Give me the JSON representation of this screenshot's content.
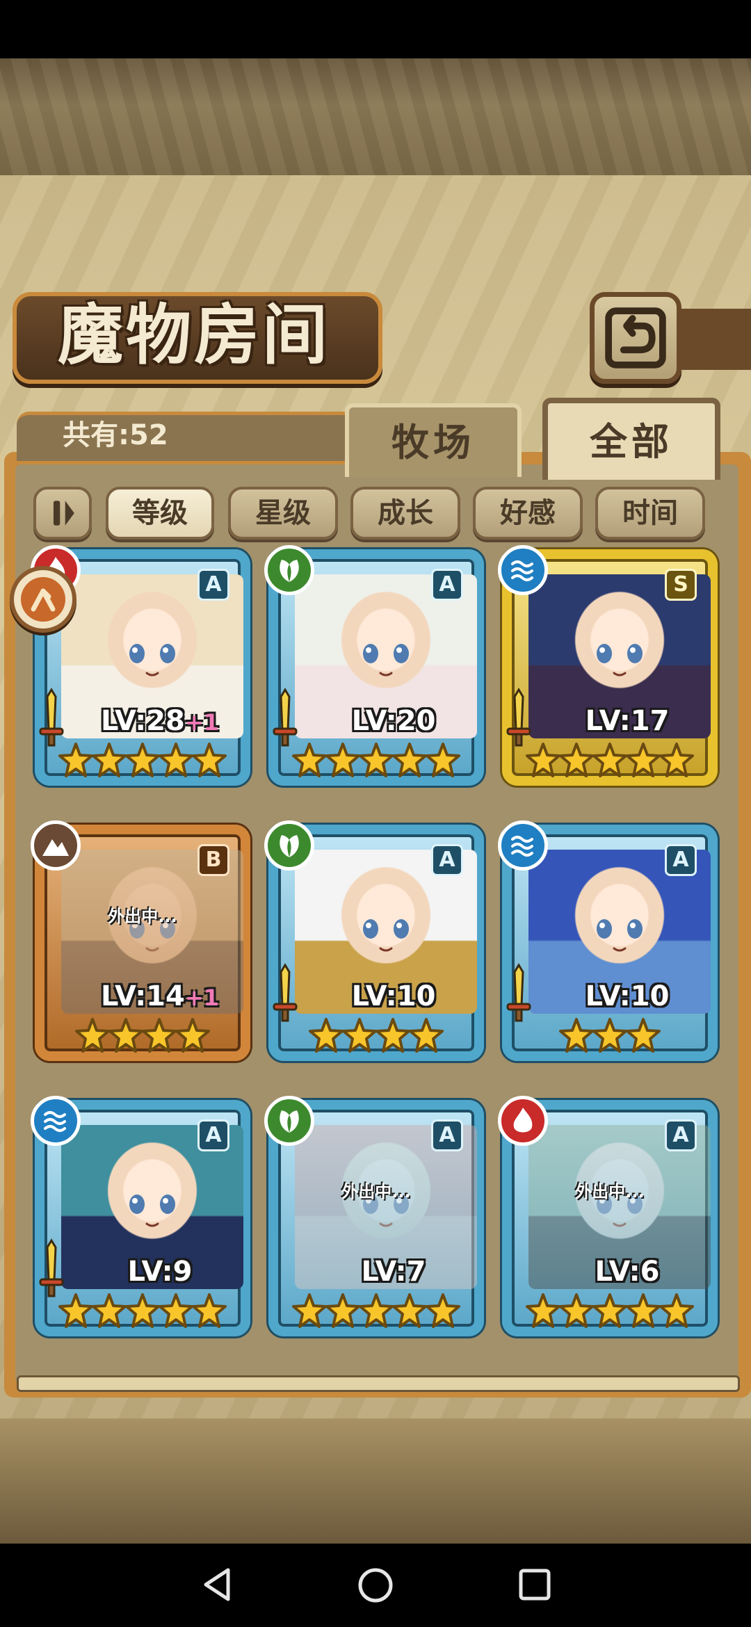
{
  "screen": {
    "title": "魔物房间",
    "count_label": "共有:52",
    "tabs": [
      {
        "label": "牧场",
        "active": false
      },
      {
        "label": "全部",
        "active": true
      }
    ],
    "sort_buttons": [
      {
        "label": "等级",
        "active": true
      },
      {
        "label": "星级",
        "active": false
      },
      {
        "label": "成长",
        "active": false
      },
      {
        "label": "好感",
        "active": false
      },
      {
        "label": "时间",
        "active": false
      }
    ],
    "sort_order_icon": "sort-order-icon",
    "back_icon": "return-arrow-icon"
  },
  "monsters": [
    {
      "level": "LV:28",
      "bonus": "+1",
      "rank": "A",
      "element": "fire",
      "stars": 5,
      "frame": "blue",
      "away": false,
      "away_text": "",
      "hair": "#efe1c2",
      "cloth": "#f5f0e6"
    },
    {
      "level": "LV:20",
      "bonus": "",
      "rank": "A",
      "element": "leaf",
      "stars": 5,
      "frame": "blue",
      "away": false,
      "away_text": "",
      "hair": "#eef0ea",
      "cloth": "#f2e4e4"
    },
    {
      "level": "LV:17",
      "bonus": "",
      "rank": "S",
      "element": "water",
      "stars": 5,
      "frame": "gold",
      "away": false,
      "away_text": "",
      "hair": "#2c3b6e",
      "cloth": "#3b2d4e"
    },
    {
      "level": "LV:14",
      "bonus": "+1",
      "rank": "B",
      "element": "earth",
      "stars": 4,
      "frame": "bronze",
      "away": true,
      "away_text": "外出中...",
      "hair": "#c9b48a",
      "cloth": "#6f6f74"
    },
    {
      "level": "LV:10",
      "bonus": "",
      "rank": "A",
      "element": "leaf",
      "stars": 4,
      "frame": "blue",
      "away": false,
      "away_text": "",
      "hair": "#f4f4f4",
      "cloth": "#c9a24a"
    },
    {
      "level": "LV:10",
      "bonus": "",
      "rank": "A",
      "element": "water",
      "stars": 3,
      "frame": "blue",
      "away": false,
      "away_text": "",
      "hair": "#3556b8",
      "cloth": "#5f8ed1"
    },
    {
      "level": "LV:9",
      "bonus": "",
      "rank": "A",
      "element": "water",
      "stars": 5,
      "frame": "blue",
      "away": false,
      "away_text": "",
      "hair": "#3f8f9e",
      "cloth": "#23325c"
    },
    {
      "level": "LV:7",
      "bonus": "",
      "rank": "A",
      "element": "leaf",
      "stars": 5,
      "frame": "blue",
      "away": true,
      "away_text": "外出中...",
      "hair": "#e6a5a1",
      "cloth": "#f1c7b8"
    },
    {
      "level": "LV:6",
      "bonus": "",
      "rank": "A",
      "element": "fire",
      "stars": 5,
      "frame": "blue",
      "away": true,
      "away_text": "外出中...",
      "hair": "#7fb58e",
      "cloth": "#4c4a3c"
    }
  ],
  "element_colors": {
    "fire": "#c92a2a",
    "leaf": "#3d8a2e",
    "water": "#1f7fc2",
    "earth": "#6a4a34"
  },
  "navigation": {
    "back_icon": "triangle-back-icon",
    "home_icon": "circle-home-icon",
    "recent_icon": "square-recents-icon"
  }
}
